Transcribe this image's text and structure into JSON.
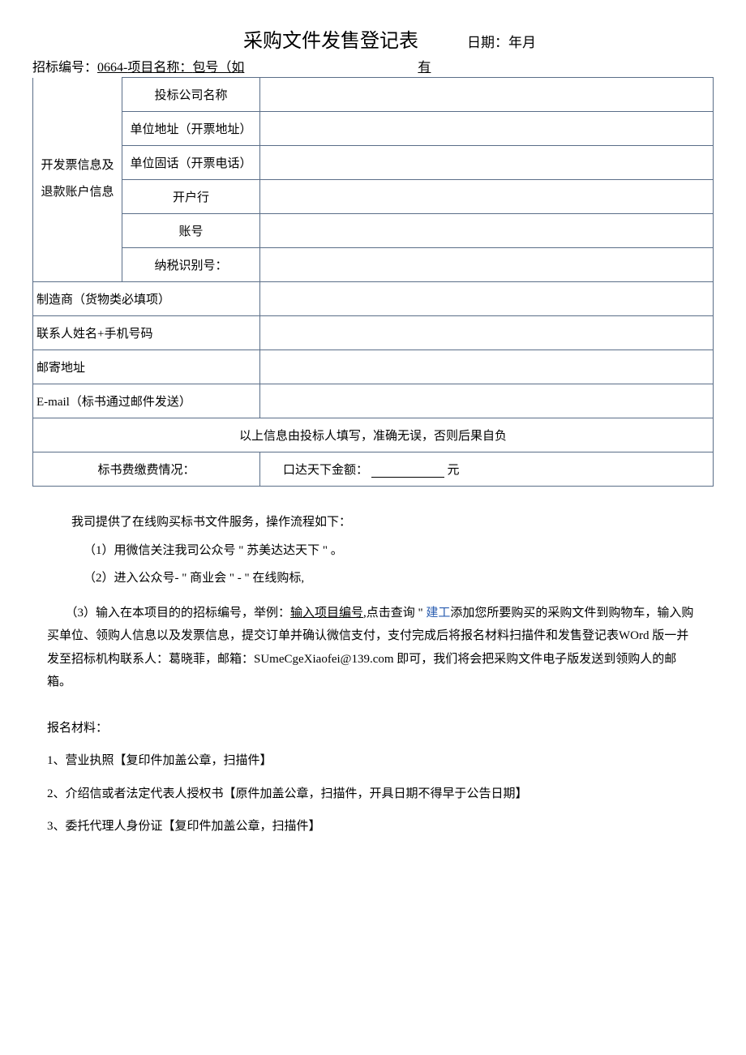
{
  "header": {
    "title": "采购文件发售登记表",
    "date_label": "日期：年月"
  },
  "subheader": {
    "bid_no_label": "招标编号：",
    "bid_no_value": "0664-",
    "project_label": "项目名称：",
    "package_label": "包号（如",
    "extra": "有"
  },
  "form": {
    "invoice_section_label": "开发票信息及退款账户信息",
    "rows": {
      "company_name": "投标公司名称",
      "unit_address": "单位地址（开票地址）",
      "unit_phone": "单位固话（开票电话）",
      "bank": "开户行",
      "account": "账号",
      "tax_id": "纳税识别号："
    },
    "manufacturer": "制造商（货物类必填项）",
    "contact": "联系人姓名+手机号码",
    "mail_address": "邮寄地址",
    "email": "E-mail（标书通过邮件发送）",
    "notice": "以上信息由投标人填写，准确无误，否则后果自负",
    "fee_label": "标书费缴费情况：",
    "fee_value_prefix": "口达天下金额：",
    "fee_value_suffix": "元"
  },
  "content": {
    "intro": "我司提供了在线购买标书文件服务，操作流程如下：",
    "step1": "（1）用微信关注我司公众号 \" 苏美达达天下 \" 。",
    "step2": "（2）进入公众号- \" 商业会 \" - \" 在线购标,",
    "step3_prefix": "（3）输入在本项目的的招标编号，举例：",
    "step3_underline": "输入项目编号",
    "step3_mid": ",点击查询 \" ",
    "step3_link": "建工",
    "step3_after": "添加您所要购买的采购文件到购物车，输入购买单位、领购人信息以及发票信息，提交订单并确认微信支付，支付完成后将报名材料扫描件和发售登记表WOrd 版一并发至招标机构联系人：葛晓菲，邮箱：SUmeCgeXiaofei@139.com 即可，我们将会把采购文件电子版发送到领购人的邮箱。",
    "materials_title": "报名材料：",
    "material1": "1、营业执照【复印件加盖公章，扫描件】",
    "material2": "2、介绍信或者法定代表人授权书【原件加盖公章，扫描件，开具日期不得早于公告日期】",
    "material3": "3、委托代理人身份证【复印件加盖公章，扫描件】"
  }
}
